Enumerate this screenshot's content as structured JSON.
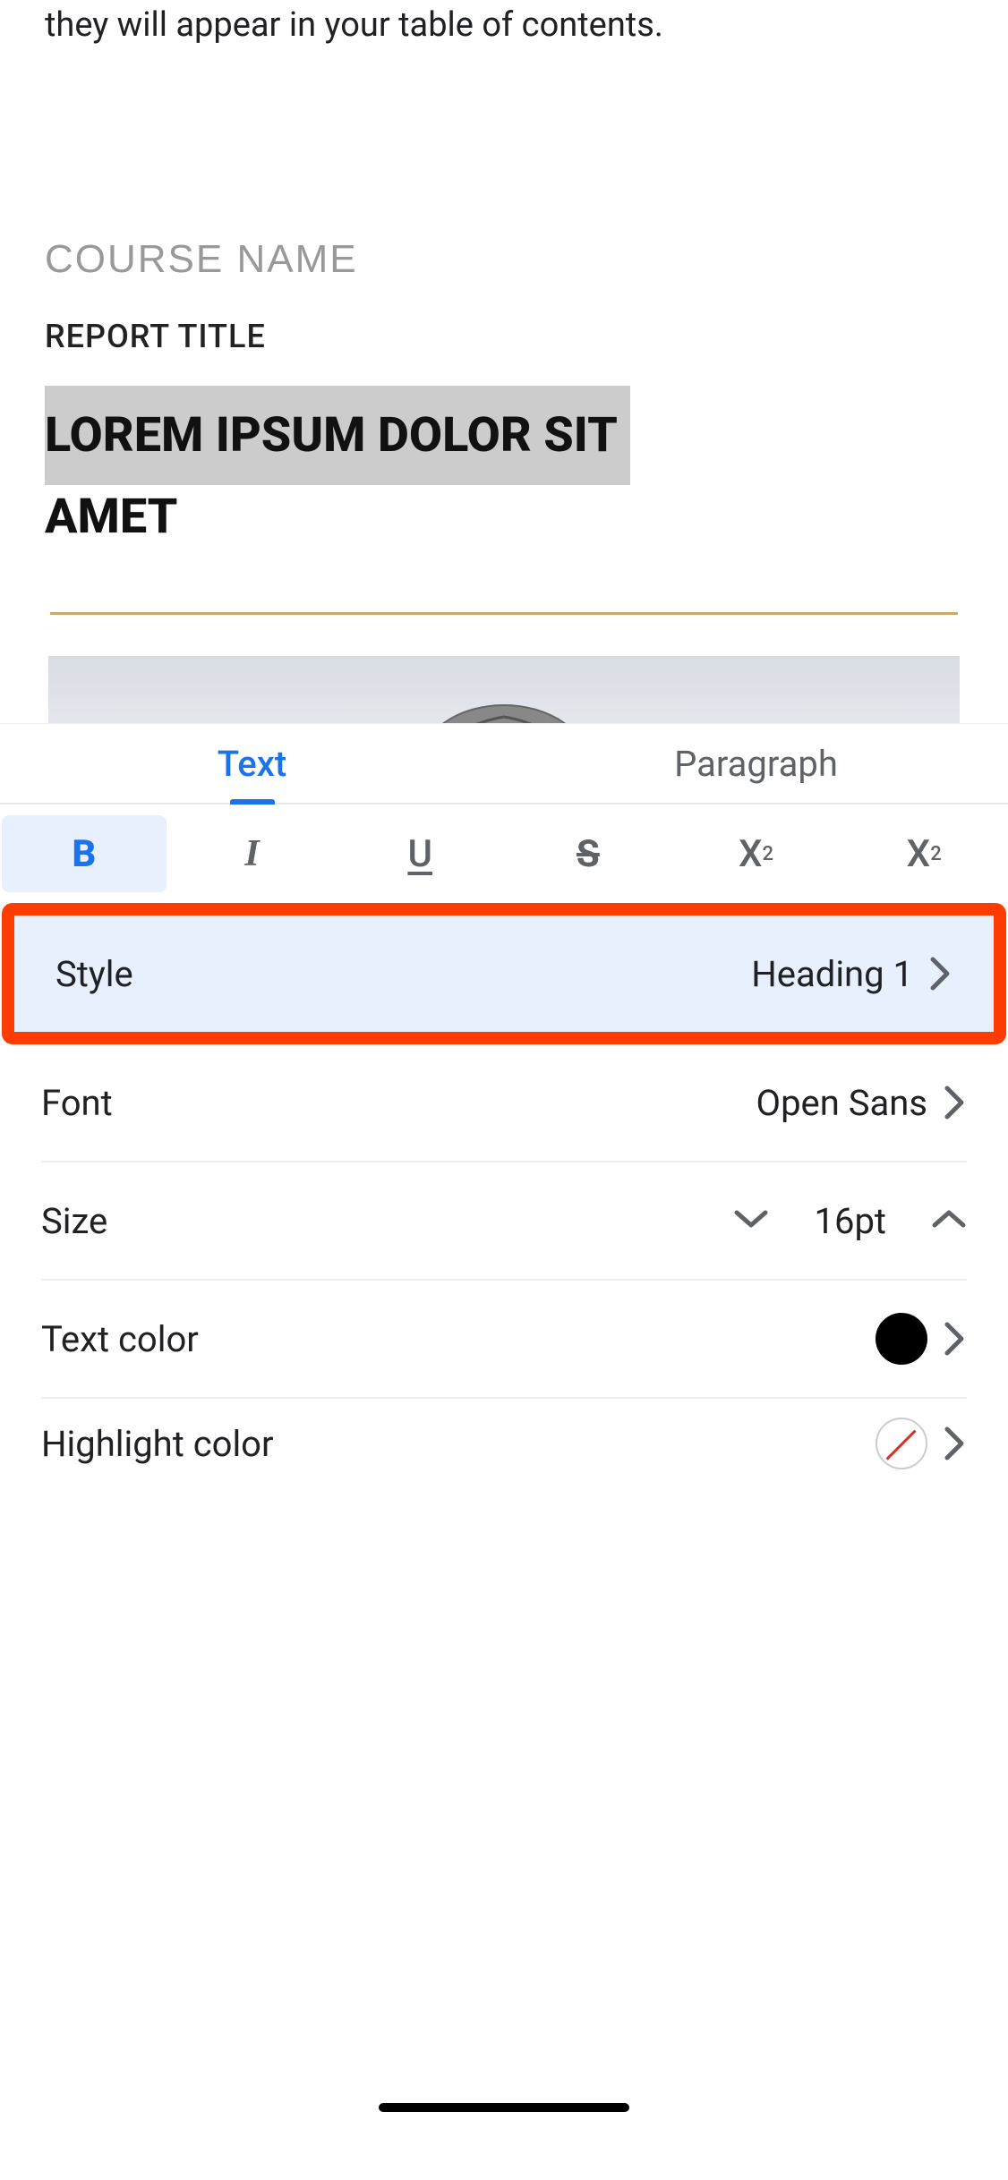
{
  "doc": {
    "instruction": "they will appear in your table of contents.",
    "course_name": "COURSE NAME",
    "report_title": "REPORT TITLE",
    "heading_line1": "LOREM IPSUM DOLOR SIT",
    "heading_line2": "AMET"
  },
  "tabs": {
    "text": "Text",
    "paragraph": "Paragraph"
  },
  "format": {
    "bold": "B",
    "italic": "I",
    "underline": "U",
    "strike": "S",
    "super": "X",
    "super_sup": "2",
    "sub": "X",
    "sub_sub": "2"
  },
  "options": {
    "style_label": "Style",
    "style_value": "Heading 1",
    "font_label": "Font",
    "font_value": "Open Sans",
    "size_label": "Size",
    "size_value": "16pt",
    "text_color_label": "Text color",
    "highlight_label": "Highlight color"
  }
}
